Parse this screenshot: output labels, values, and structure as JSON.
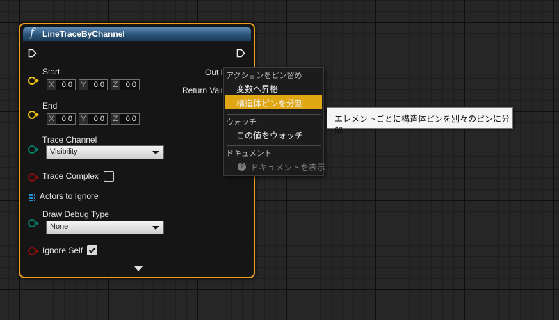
{
  "node": {
    "title": "LineTraceByChannel",
    "function_icon": "f",
    "inputs": {
      "start": {
        "label": "Start",
        "x_axis": "X",
        "x": "0.0",
        "y_axis": "Y",
        "y": "0.0",
        "z_axis": "Z",
        "z": "0.0"
      },
      "end": {
        "label": "End",
        "x_axis": "X",
        "x": "0.0",
        "y_axis": "Y",
        "y": "0.0",
        "z_axis": "Z",
        "z": "0.0"
      },
      "trace_channel": {
        "label": "Trace Channel",
        "value": "Visibility"
      },
      "trace_complex": {
        "label": "Trace Complex",
        "checked": false
      },
      "actors_to_ignore": {
        "label": "Actors to Ignore"
      },
      "draw_debug_type": {
        "label": "Draw Debug Type",
        "value": "None"
      },
      "ignore_self": {
        "label": "Ignore Self",
        "checked": true
      }
    },
    "outputs": {
      "out_hit": "Out H",
      "return_value": "Return Valu"
    }
  },
  "context_menu": {
    "section_pin_actions": "アクションをピン留め",
    "promote_to_variable": "変数へ昇格",
    "split_struct_pin": "構造体ピンを分割",
    "section_watch": "ウォッチ",
    "watch_value": "この値をウォッチ",
    "section_documentation": "ドキュメント",
    "show_documentation": "ドキュメントを表示",
    "help_glyph": "?"
  },
  "tooltip": {
    "text": "エレメントごとに構造体ピンを別々のピンに分解"
  },
  "colors": {
    "node_border": "#f0a01e",
    "header": "#2c5478",
    "vector_pin": "#f2c20f",
    "byte_pin": "#0a7a68",
    "bool_pin": "#8a0d0d",
    "array_pin": "#1f8fd0",
    "menu_highlight": "#e1a712"
  }
}
